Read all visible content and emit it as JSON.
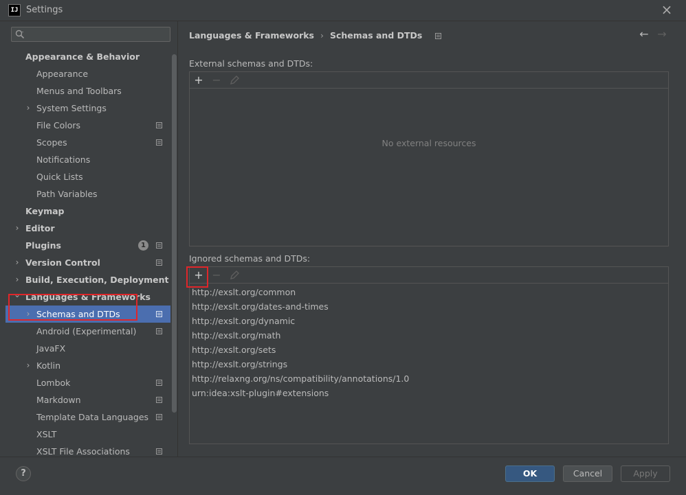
{
  "window": {
    "title": "Settings",
    "logo_text": "IJ"
  },
  "search": {
    "placeholder": "",
    "value": ""
  },
  "tree": {
    "items": [
      {
        "label": "Appearance & Behavior",
        "level": 0,
        "bold": true,
        "expander": "none",
        "config": false
      },
      {
        "label": "Appearance",
        "level": 1,
        "bold": false,
        "expander": "none",
        "config": false
      },
      {
        "label": "Menus and Toolbars",
        "level": 1,
        "bold": false,
        "expander": "none",
        "config": false
      },
      {
        "label": "System Settings",
        "level": 1,
        "bold": false,
        "expander": "collapsed",
        "config": false
      },
      {
        "label": "File Colors",
        "level": 1,
        "bold": false,
        "expander": "none",
        "config": true
      },
      {
        "label": "Scopes",
        "level": 1,
        "bold": false,
        "expander": "none",
        "config": true
      },
      {
        "label": "Notifications",
        "level": 1,
        "bold": false,
        "expander": "none",
        "config": false
      },
      {
        "label": "Quick Lists",
        "level": 1,
        "bold": false,
        "expander": "none",
        "config": false
      },
      {
        "label": "Path Variables",
        "level": 1,
        "bold": false,
        "expander": "none",
        "config": false
      },
      {
        "label": "Keymap",
        "level": 0,
        "bold": true,
        "expander": "none",
        "config": false
      },
      {
        "label": "Editor",
        "level": 0,
        "bold": true,
        "expander": "collapsed",
        "config": false
      },
      {
        "label": "Plugins",
        "level": 0,
        "bold": true,
        "expander": "none",
        "config": true,
        "badge": "1"
      },
      {
        "label": "Version Control",
        "level": 0,
        "bold": true,
        "expander": "collapsed",
        "config": true
      },
      {
        "label": "Build, Execution, Deployment",
        "level": 0,
        "bold": true,
        "expander": "collapsed",
        "config": false
      },
      {
        "label": "Languages & Frameworks",
        "level": 0,
        "bold": true,
        "expander": "expanded",
        "config": false
      },
      {
        "label": "Schemas and DTDs",
        "level": 1,
        "bold": false,
        "expander": "collapsed",
        "config": true,
        "selected": true
      },
      {
        "label": "Android (Experimental)",
        "level": 1,
        "bold": false,
        "expander": "none",
        "config": true
      },
      {
        "label": "JavaFX",
        "level": 1,
        "bold": false,
        "expander": "none",
        "config": false
      },
      {
        "label": "Kotlin",
        "level": 1,
        "bold": false,
        "expander": "collapsed",
        "config": false
      },
      {
        "label": "Lombok",
        "level": 1,
        "bold": false,
        "expander": "none",
        "config": true
      },
      {
        "label": "Markdown",
        "level": 1,
        "bold": false,
        "expander": "none",
        "config": true
      },
      {
        "label": "Template Data Languages",
        "level": 1,
        "bold": false,
        "expander": "none",
        "config": true
      },
      {
        "label": "XSLT",
        "level": 1,
        "bold": false,
        "expander": "none",
        "config": false
      },
      {
        "label": "XSLT File Associations",
        "level": 1,
        "bold": false,
        "expander": "none",
        "config": true
      }
    ]
  },
  "breadcrumb": {
    "parent": "Languages & Frameworks",
    "separator": "›",
    "current": "Schemas and DTDs"
  },
  "nav": {
    "back_glyph": "←",
    "forward_glyph": "→"
  },
  "external": {
    "label": "External schemas and DTDs:",
    "empty_text": "No external resources"
  },
  "ignored": {
    "label": "Ignored schemas and DTDs:",
    "items": [
      "http://exslt.org/common",
      "http://exslt.org/dates-and-times",
      "http://exslt.org/dynamic",
      "http://exslt.org/math",
      "http://exslt.org/sets",
      "http://exslt.org/strings",
      "http://relaxng.org/ns/compatibility/annotations/1.0",
      "urn:idea:xslt-plugin#extensions"
    ]
  },
  "toolbar": {
    "add_glyph": "+",
    "remove_glyph": "−"
  },
  "buttons": {
    "help": "?",
    "ok": "OK",
    "cancel": "Cancel",
    "apply": "Apply"
  },
  "colors": {
    "background": "#3c3f41",
    "selection": "#4b6eaf",
    "ok_button": "#365880",
    "highlight": "#e0262a"
  },
  "icons": {
    "search": "search-icon",
    "close": "close-icon",
    "config": "config-icon",
    "chevron_right": "chevron-right-icon",
    "chevron_down": "chevron-down-icon",
    "add": "add-icon",
    "remove": "remove-icon",
    "edit": "edit-icon",
    "back": "back-arrow-icon",
    "forward": "forward-arrow-icon",
    "help": "help-icon"
  }
}
